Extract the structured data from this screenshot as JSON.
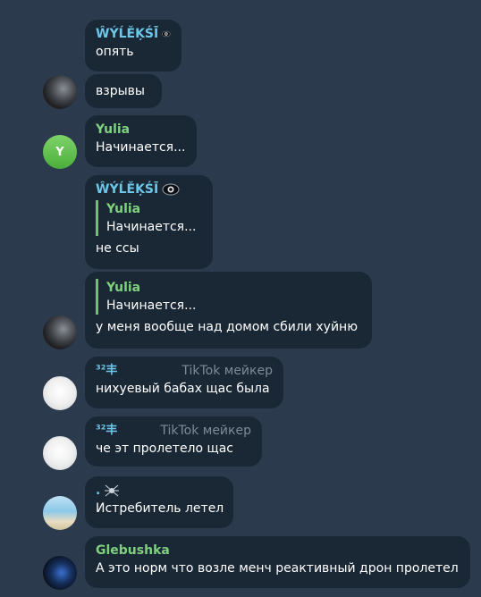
{
  "colors": {
    "background": "#2b3b4d",
    "bubble": "#1a2836",
    "name_blue": "#6ec6e8",
    "name_green": "#7fd07f",
    "reply_bar": "#6bc56b",
    "muted": "#7d8a98"
  },
  "messages": [
    {
      "sender": "ŴÝĹĚĶŚĪ",
      "sender_icon": "eye-icon",
      "text": "опять"
    },
    {
      "text": "взрывы",
      "avatar": "avatar-photo-dark"
    },
    {
      "sender": "Yulia",
      "text": "Начинается...",
      "avatar_letter": "Y"
    },
    {
      "sender": "ŴÝĹĚĶŚĪ",
      "sender_icon": "eye-icon",
      "reply": {
        "name": "Yulia",
        "text": "Начинается..."
      },
      "text": "не ссы"
    },
    {
      "reply": {
        "name": "Yulia",
        "text": "Начинается..."
      },
      "text": "у меня вообще над домом сбили хуйню",
      "avatar": "avatar-photo-dark"
    },
    {
      "sender": "³²丰",
      "tag": "TikTok мейкер",
      "text": "нихуевый бабах щас была",
      "avatar": "avatar-sketch"
    },
    {
      "sender": "³²丰",
      "tag": "TikTok мейкер",
      "text": "че эт пролетело щас",
      "avatar": "avatar-sketch"
    },
    {
      "sender": ".",
      "sender_icon": "spider-icon",
      "text": "Истребитель летел",
      "avatar": "avatar-beach"
    },
    {
      "sender": "Glebushka",
      "text": "А это норм что возле менч реактивный дрон пролетел",
      "avatar": "avatar-dark-blue"
    }
  ]
}
